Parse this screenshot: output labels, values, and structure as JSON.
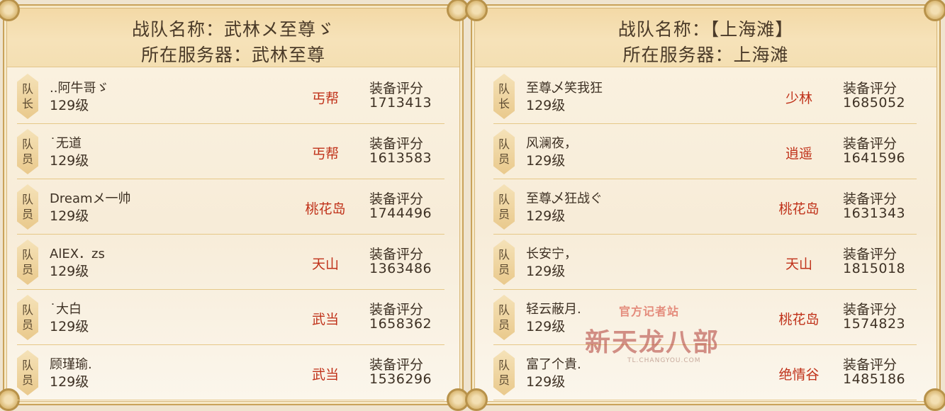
{
  "teams": [
    {
      "team_name": "战队名称：武林メ至尊ゞ",
      "server": "所在服务器：武林至尊",
      "members": [
        {
          "role": [
            "队",
            "长"
          ],
          "name": "..阿牛哥ゞ",
          "level": "129级",
          "sect": "丐帮",
          "score_label": "装备评分",
          "score": "1713413"
        },
        {
          "role": [
            "队",
            "员"
          ],
          "name": "˙无道",
          "level": "129级",
          "sect": "丐帮",
          "score_label": "装备评分",
          "score": "1613583"
        },
        {
          "role": [
            "队",
            "员"
          ],
          "name": "Dreamメ一帅",
          "level": "129级",
          "sect": "桃花岛",
          "score_label": "装备评分",
          "score": "1744496"
        },
        {
          "role": [
            "队",
            "员"
          ],
          "name": "AlEX．zs",
          "level": "129级",
          "sect": "天山",
          "score_label": "装备评分",
          "score": "1363486"
        },
        {
          "role": [
            "队",
            "员"
          ],
          "name": "˙大白",
          "level": "129级",
          "sect": "武当",
          "score_label": "装备评分",
          "score": "1658362"
        },
        {
          "role": [
            "队",
            "员"
          ],
          "name": "顾瑾瑜.",
          "level": "129级",
          "sect": "武当",
          "score_label": "装备评分",
          "score": "1536296"
        }
      ]
    },
    {
      "team_name": "战队名称：【上海滩】",
      "server": "所在服务器：上海滩",
      "members": [
        {
          "role": [
            "队",
            "长"
          ],
          "name": "至尊乄笑我狂",
          "level": "129级",
          "sect": "少林",
          "score_label": "装备评分",
          "score": "1685052"
        },
        {
          "role": [
            "队",
            "员"
          ],
          "name": "风澜夜，",
          "level": "129级",
          "sect": "逍遥",
          "score_label": "装备评分",
          "score": "1641596"
        },
        {
          "role": [
            "队",
            "员"
          ],
          "name": "至尊乄狂战ぐ",
          "level": "129级",
          "sect": "桃花岛",
          "score_label": "装备评分",
          "score": "1631343"
        },
        {
          "role": [
            "队",
            "员"
          ],
          "name": "长安宁，",
          "level": "129级",
          "sect": "天山",
          "score_label": "装备评分",
          "score": "1815018"
        },
        {
          "role": [
            "队",
            "员"
          ],
          "name": "轻云蔽月.",
          "level": "129级",
          "sect": "桃花岛",
          "score_label": "装备评分",
          "score": "1574823"
        },
        {
          "role": [
            "队",
            "员"
          ],
          "name": "富了个貴.",
          "level": "129级",
          "sect": "绝情谷",
          "score_label": "装备评分",
          "score": "1485186"
        }
      ]
    }
  ],
  "watermark": {
    "top": "官方记者站",
    "main": "新天龙八部",
    "url": "TL.CHANGYOU.COM"
  },
  "colors": {
    "accent_gold": "#c9a25a",
    "header_bg": "#f3d9a6",
    "sect_red": "#c0321a",
    "text_dark": "#3e3124"
  }
}
